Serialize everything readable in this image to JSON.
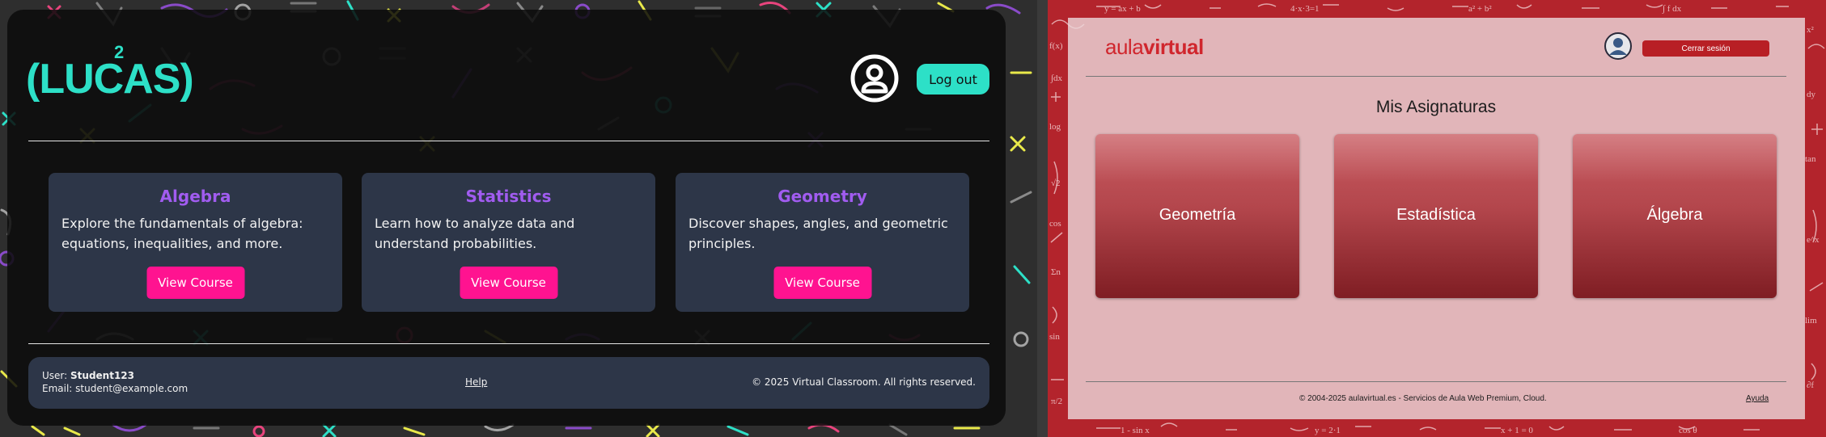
{
  "left_app": {
    "logo": {
      "text": "(LUCAS)",
      "superscript": "2"
    },
    "header": {
      "logout_label": "Log out",
      "user_icon": "user-circle-icon"
    },
    "courses": [
      {
        "title": "Algebra",
        "description": "Explore the fundamentals of algebra: equations, inequalities, and more.",
        "button": "View Course"
      },
      {
        "title": "Statistics",
        "description": "Learn how to analyze data and understand probabilities.",
        "button": "View Course"
      },
      {
        "title": "Geometry",
        "description": "Discover shapes, angles, and geometric principles.",
        "button": "View Course"
      }
    ],
    "footer": {
      "user_label": "User:",
      "username": "Student123",
      "email_label": "Email:",
      "email": "student@example.com",
      "help": "Help",
      "copyright": "© 2025 Virtual Classroom. All rights reserved."
    },
    "colors": {
      "accent": "#2de0c7",
      "title": "#a15cf0",
      "button": "#ff1390",
      "card": "#2d3648"
    }
  },
  "right_app": {
    "logo": {
      "part1": "aula",
      "part2": "virtual"
    },
    "header": {
      "logout_label": "Cerrar sesión",
      "avatar_icon": "user-avatar-icon"
    },
    "page_title": "Mis Asignaturas",
    "subjects": [
      {
        "name": "Geometría"
      },
      {
        "name": "Estadística"
      },
      {
        "name": "Álgebra"
      }
    ],
    "footer": {
      "copyright": "© 2004-2025 aulavirtual.es - Servicios de Aula Web Premium, Cloud.",
      "help": "Ayuda"
    },
    "colors": {
      "brand": "#d0262d",
      "background": "#b3242c",
      "card": "#b3464c"
    }
  }
}
